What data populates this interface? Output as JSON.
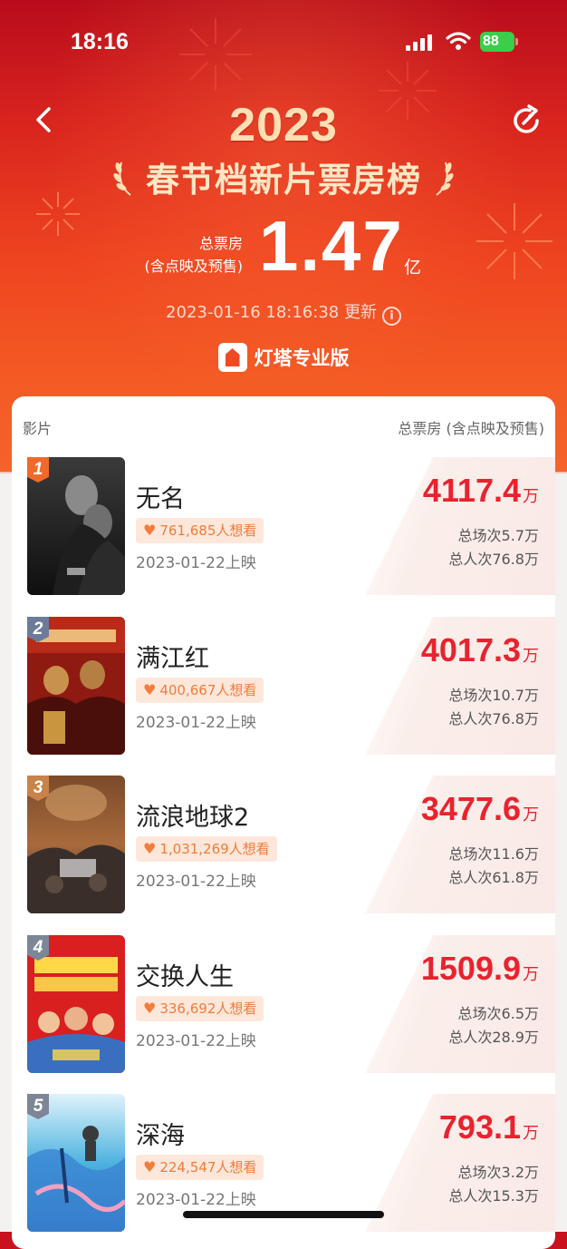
{
  "status": {
    "time": "18:16",
    "battery": "88"
  },
  "header": {
    "year": "2023",
    "title": "春节档新片票房榜",
    "total_label": "总票房",
    "total_sublabel": "(含点映及预售)",
    "total_value": "1.47",
    "total_unit": "亿",
    "updated": "2023-01-16 18:16:38 更新",
    "brand": "灯塔专业版"
  },
  "table": {
    "col_film": "影片",
    "col_gross": "总票房 (含点映及预售)",
    "rows": [
      {
        "rank": "1",
        "name": "无名",
        "want": "761,685人想看",
        "date": "2023-01-22上映",
        "gross": "4117.4",
        "unit": "万",
        "shows": "总场次5.7万",
        "viewers": "总人次76.8万"
      },
      {
        "rank": "2",
        "name": "满江红",
        "want": "400,667人想看",
        "date": "2023-01-22上映",
        "gross": "4017.3",
        "unit": "万",
        "shows": "总场次10.7万",
        "viewers": "总人次76.8万"
      },
      {
        "rank": "3",
        "name": "流浪地球2",
        "want": "1,031,269人想看",
        "date": "2023-01-22上映",
        "gross": "3477.6",
        "unit": "万",
        "shows": "总场次11.6万",
        "viewers": "总人次61.8万"
      },
      {
        "rank": "4",
        "name": "交换人生",
        "want": "336,692人想看",
        "date": "2023-01-22上映",
        "gross": "1509.9",
        "unit": "万",
        "shows": "总场次6.5万",
        "viewers": "总人次28.9万"
      },
      {
        "rank": "5",
        "name": "深海",
        "want": "224,547人想看",
        "date": "2023-01-22上映",
        "gross": "793.1",
        "unit": "万",
        "shows": "总场次3.2万",
        "viewers": "总人次15.3万"
      }
    ]
  },
  "icons": {
    "back": "back-icon",
    "refresh": "share-refresh-icon",
    "info": "info-icon",
    "heart": "heart-icon"
  },
  "colors": {
    "accent_red": "#e8232e",
    "header_red": "#d8231e",
    "want_bg": "#fde7da",
    "want_text": "#f07c3a",
    "rank1": "#f06a2a",
    "rank2": "#6d7b9a",
    "rank3": "#c8834a",
    "rank_other": "#7d8696"
  }
}
